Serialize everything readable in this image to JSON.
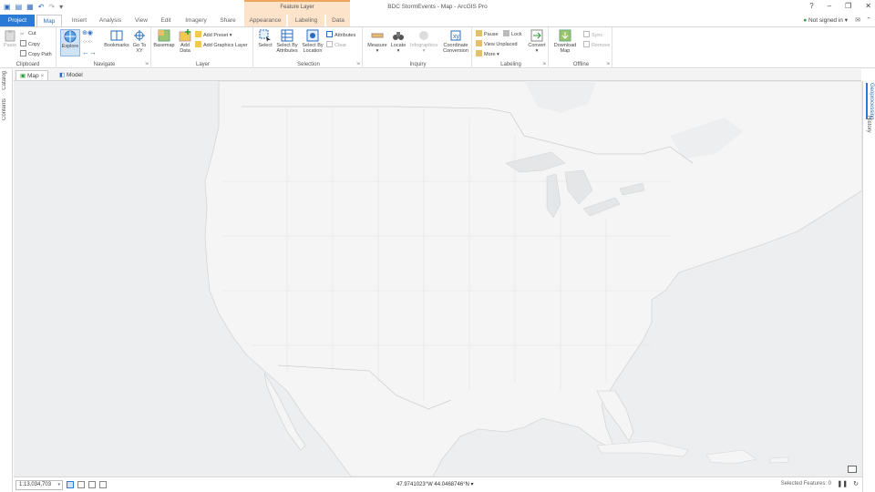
{
  "window": {
    "context_tab_header": "Feature Layer",
    "app_title": "BDC StormEvents - Map - ArcGIS Pro"
  },
  "tabs": [
    {
      "label": "Project"
    },
    {
      "label": "Map"
    },
    {
      "label": "Insert"
    },
    {
      "label": "Analysis"
    },
    {
      "label": "View"
    },
    {
      "label": "Edit"
    },
    {
      "label": "Imagery"
    },
    {
      "label": "Share"
    },
    {
      "label": "Appearance"
    },
    {
      "label": "Labeling"
    },
    {
      "label": "Data"
    }
  ],
  "account": {
    "signin": "Not signed in"
  },
  "ribbon": {
    "clipboard": {
      "label": "Clipboard",
      "paste": "Paste",
      "cut": "Cut",
      "copy": "Copy",
      "copy_path": "Copy Path"
    },
    "navigate": {
      "label": "Navigate",
      "explore": "Explore",
      "bookmarks": "Bookmarks",
      "go_to_xy": "Go To XY"
    },
    "layer": {
      "label": "Layer",
      "basemap": "Basemap",
      "add_data": "Add Data",
      "add_preset": "Add Preset",
      "add_graphics": "Add Graphics Layer"
    },
    "selection": {
      "label": "Selection",
      "select": "Select",
      "by_attributes": "Select By Attributes",
      "by_location": "Select By Location",
      "attributes": "Attributes",
      "clear": "Clear"
    },
    "inquiry": {
      "label": "Inquiry",
      "measure": "Measure",
      "locate": "Locate",
      "infographics": "Infographics",
      "coord_conv": "Coordinate Conversion"
    },
    "labeling": {
      "label": "Labeling",
      "pause": "Pause",
      "lock": "Lock",
      "view_unplaced": "View Unplaced",
      "more": "More",
      "convert": "Convert"
    },
    "offline": {
      "label": "Offline",
      "download": "Download Map",
      "sync": "Sync",
      "remove": "Remove"
    }
  },
  "left_dock": {
    "catalog": "Catalog",
    "contents": "Contents"
  },
  "right_dock": {
    "geoprocessing": "Geoprocessing",
    "history": "History"
  },
  "view_tabs": [
    {
      "label": "Map"
    },
    {
      "label": "Model"
    }
  ],
  "status": {
    "scale": "1:13,034,703",
    "coords": "47.9741023°W 44.0468746°N",
    "selected": "Selected Features: 0"
  },
  "colors": {
    "accent": "#2b7bd6",
    "map_land": "#f4f4f4",
    "map_water": "#eceeef",
    "context": "#fde3c9"
  }
}
